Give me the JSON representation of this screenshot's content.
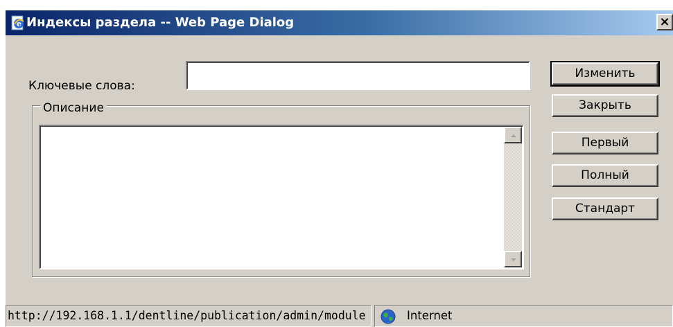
{
  "window": {
    "title": "Индексы раздела -- Web Page Dialog",
    "close_symbol": "×",
    "icons": {
      "app": "ie-page-icon",
      "close": "close-icon"
    }
  },
  "form": {
    "keywords_label": "Ключевые слова:",
    "keywords_value": "",
    "description_legend": "Описание",
    "description_value": ""
  },
  "buttons": {
    "change": "Изменить",
    "close": "Закрыть",
    "first": "Первый",
    "full": "Полный",
    "standard": "Стандарт"
  },
  "status_bar": {
    "url": "http://192.168.1.1/dentline/publication/admin/module",
    "zone": "Internet",
    "zone_icon": "globe-icon"
  },
  "colors": {
    "title_gradient_start": "#0a246a",
    "title_gradient_end": "#a6caf0",
    "dialog_bg": "#d4d0c8"
  }
}
